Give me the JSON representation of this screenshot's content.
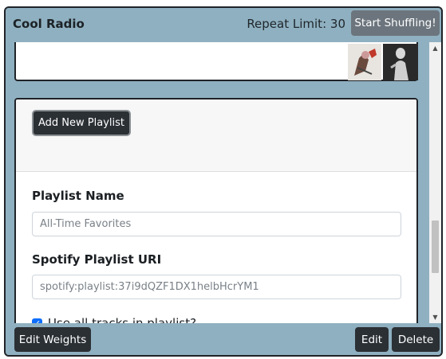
{
  "header": {
    "title": "Cool Radio",
    "repeat_limit_label": "Repeat Limit:",
    "repeat_limit_value": "30",
    "shuffle_button": "Start Shuffling!"
  },
  "playlist_form": {
    "add_button": "Add New Playlist",
    "name_label": "Playlist Name",
    "name_placeholder": "All-Time Favorites",
    "uri_label": "Spotify Playlist URI",
    "uri_placeholder": "spotify:playlist:37i9dQZF1DX1helbHcrYM1",
    "use_all_label": "Use all tracks in playlist?",
    "use_all_checked": true
  },
  "footer": {
    "edit_weights": "Edit Weights",
    "edit": "Edit",
    "delete": "Delete"
  },
  "colors": {
    "background": "#8fb0c0",
    "dark_button": "#2b3035",
    "secondary_button": "#6c757d",
    "checkbox": "#0d6efd"
  }
}
